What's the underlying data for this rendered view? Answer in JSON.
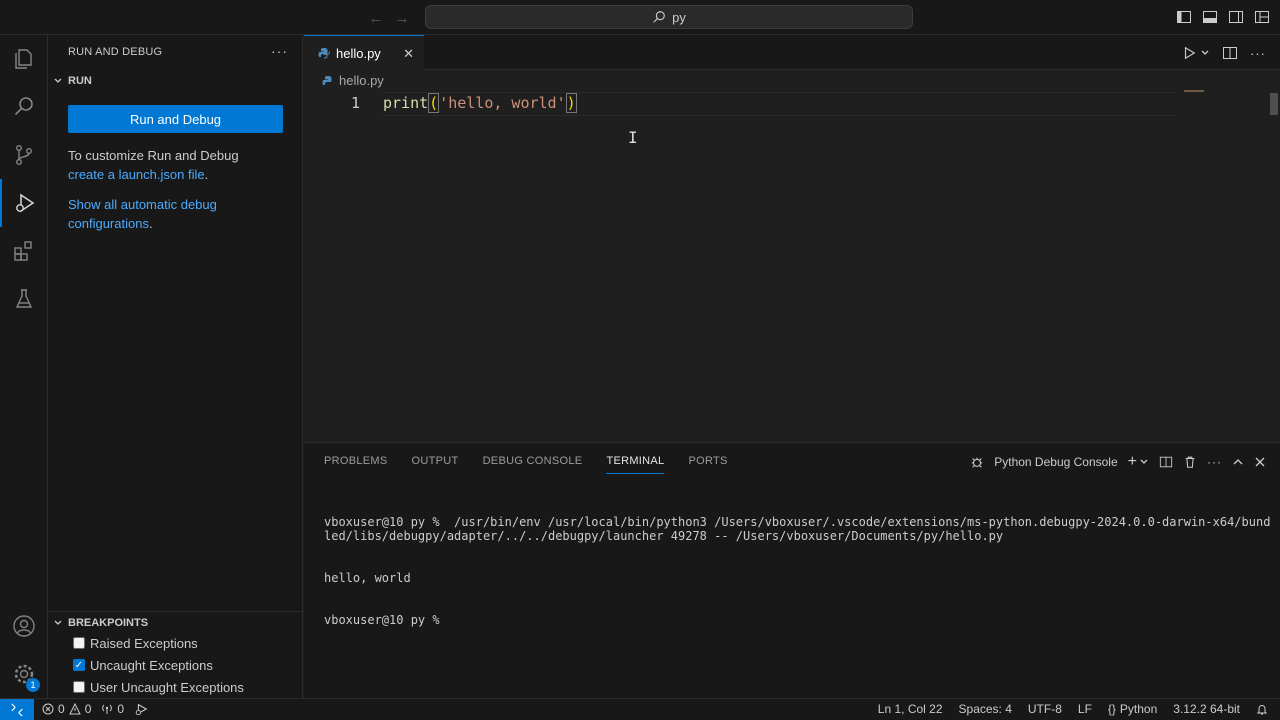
{
  "titlebar": {
    "search_text": "py",
    "back_icon": "arrow-left-icon",
    "forward_icon": "arrow-right-icon"
  },
  "sidebar": {
    "title": "RUN AND DEBUG",
    "run_section": "RUN",
    "run_button": "Run and Debug",
    "customize_text": "To customize Run and Debug",
    "create_link": "create a launch.json file",
    "period": ".",
    "show_link": "Show all automatic debug configurations",
    "breakpoints_section": "BREAKPOINTS",
    "breakpoints": [
      {
        "label": "Raised Exceptions",
        "checked": false
      },
      {
        "label": "Uncaught Exceptions",
        "checked": true
      },
      {
        "label": "User Uncaught Exceptions",
        "checked": false
      }
    ]
  },
  "activity": {
    "settings_badge": "1"
  },
  "editor": {
    "tab_label": "hello.py",
    "breadcrumb": "hello.py",
    "line_number": "1",
    "code_fn": "print",
    "code_open": "(",
    "code_str": "'hello, world'",
    "code_close": ")"
  },
  "panel": {
    "tabs": [
      "PROBLEMS",
      "OUTPUT",
      "DEBUG CONSOLE",
      "TERMINAL",
      "PORTS"
    ],
    "active_tab": "TERMINAL",
    "console_name": "Python Debug Console",
    "terminal_lines": [
      "vboxuser@10 py %  /usr/bin/env /usr/local/bin/python3 /Users/vboxuser/.vscode/extensions/ms-python.debugpy-2024.0.0-darwin-x64/bundled/libs/debugpy/adapter/../../debugpy/launcher 49278 -- /Users/vboxuser/Documents/py/hello.py",
      "hello, world",
      "vboxuser@10 py % "
    ]
  },
  "statusbar": {
    "errors": "0",
    "warnings": "0",
    "ports": "0",
    "position": "Ln 1, Col 22",
    "spaces": "Spaces: 4",
    "encoding": "UTF-8",
    "eol": "LF",
    "language": "Python",
    "interpreter": "3.12.2 64-bit"
  },
  "colors": {
    "accent": "#0078d4",
    "link": "#4daafc"
  }
}
